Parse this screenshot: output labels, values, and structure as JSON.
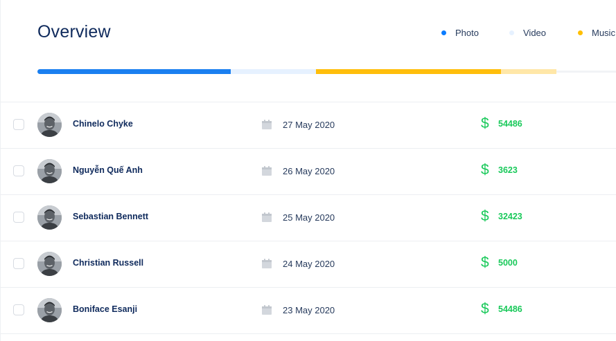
{
  "title": "Overview",
  "legend": [
    {
      "label": "Photo",
      "color": "#0a7cff"
    },
    {
      "label": "Video",
      "color": "#e6f1ff"
    },
    {
      "label": "Music",
      "color": "#ffbf00"
    }
  ],
  "progress": [
    {
      "name": "photo",
      "color": "#1a7ff0",
      "fraction": 0.334
    },
    {
      "name": "video",
      "color": "#e6f1ff",
      "fraction": 0.147
    },
    {
      "name": "music",
      "color": "#ffbe0b",
      "fraction": 0.319
    },
    {
      "name": "music-light",
      "color": "#ffe7a8",
      "fraction": 0.096
    }
  ],
  "rows": [
    {
      "name": "Chinelo Chyke",
      "date": "27 May 2020",
      "currency": "$",
      "amount": "54486"
    },
    {
      "name": "Nguyễn Quế Anh",
      "date": "26 May 2020",
      "currency": "$",
      "amount": "3623"
    },
    {
      "name": "Sebastian Bennett",
      "date": "25 May 2020",
      "currency": "$",
      "amount": "32423"
    },
    {
      "name": "Christian Russell",
      "date": "24 May 2020",
      "currency": "$",
      "amount": "5000"
    },
    {
      "name": "Boniface Esanji",
      "date": "23 May 2020",
      "currency": "$",
      "amount": "54486"
    }
  ]
}
